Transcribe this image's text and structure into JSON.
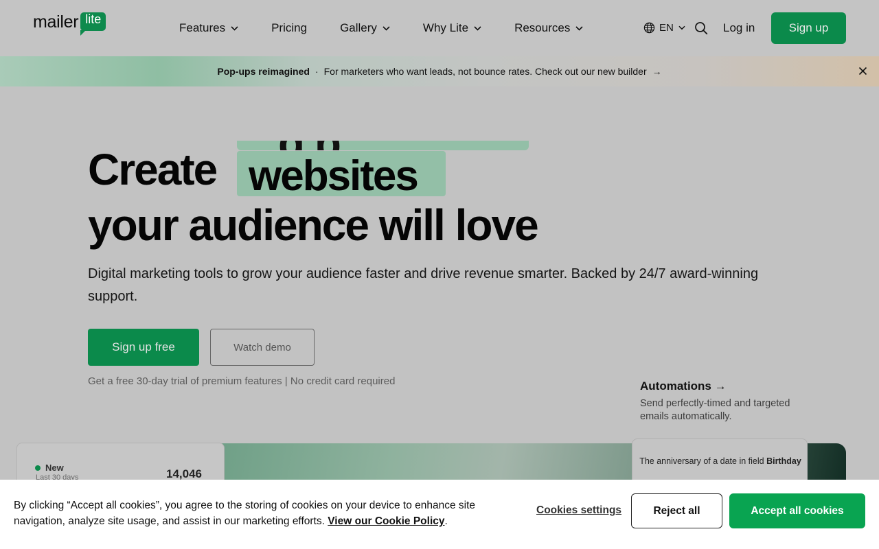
{
  "header": {
    "logo_text": "mailer",
    "logo_badge": "lite",
    "nav": [
      {
        "label": "Features",
        "has_dropdown": true
      },
      {
        "label": "Pricing",
        "has_dropdown": false
      },
      {
        "label": "Gallery",
        "has_dropdown": true
      },
      {
        "label": "Why Lite",
        "has_dropdown": true
      },
      {
        "label": "Resources",
        "has_dropdown": true
      }
    ],
    "language": "EN",
    "login_label": "Log in",
    "signup_label": "Sign up"
  },
  "banner": {
    "title": "Pop-ups reimagined",
    "separator": "·",
    "text": "For marketers who want leads, not bounce rates. Check out our new builder",
    "arrow": "→"
  },
  "hero": {
    "title_prefix": "Create",
    "rotating_word": "websites",
    "rotating_word_partial": "g p",
    "title_line2": "your audience will love",
    "subtitle": "Digital marketing tools to grow your audience faster and drive revenue smarter. Backed by 24/7 award-winning support.",
    "primary_cta": "Sign up free",
    "secondary_cta": "Watch demo",
    "trial_note": "Get a free 30-day trial of premium features | No credit card required"
  },
  "automations": {
    "title": "Automations →",
    "description": "Send perfectly-timed and targeted emails automatically.",
    "card_text": "The anniversary of a date in field",
    "card_field": "Birthday"
  },
  "stats_card": {
    "label": "New",
    "period": "Last 30 days",
    "value": "14,046"
  },
  "cookie": {
    "text": "By clicking “Accept all cookies”, you agree to the storing of cookies on your device to enhance site navigation, analyze site usage, and assist in our marketing efforts.",
    "policy_link": "View our Cookie Policy",
    "settings_label": "Cookies settings",
    "reject_label": "Reject all",
    "accept_label": "Accept all cookies"
  },
  "colors": {
    "brand_green": "#0b8a4b",
    "accept_green": "#09a451",
    "highlight": "#93bfa7"
  }
}
